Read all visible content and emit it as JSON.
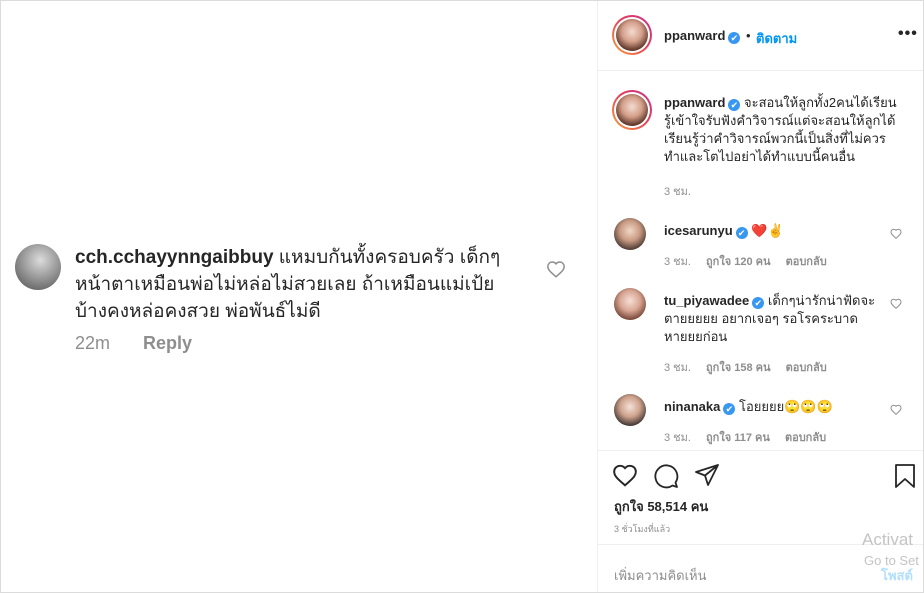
{
  "left_comment": {
    "username": "cch.cchayynngaibbuy",
    "text": " แหมบกันทั้งครอบครัว เด็กๆ หน้าตาเหมือนพ่อไม่หล่อไม่สวยเลย ถ้าเหมือนแม่เป้ย บ้างคงหล่อคงสวย พ่อพันธ์ไม่ดี",
    "time": "22m",
    "reply_label": "Reply"
  },
  "header": {
    "username": "ppanward",
    "verified_mark": "✔",
    "dot": "•",
    "follow_label": "ติดตาม",
    "more_label": "•••"
  },
  "caption": {
    "username": "ppanward",
    "verified_mark": "✔",
    "text": " จะสอนให้ลูกทั้ง2คนได้เรียนรู้เข้าใจรับฟังคำวิจารณ์แต่จะสอนให้ลูกได้เรียนรู้ว่าคำวิจารณ์พวกนี้เป็นสิ่งที่ไม่ควรทำและโตไปอย่าได้ทำแบบนี้คนอื่น",
    "time": "3 ชม."
  },
  "comments": [
    {
      "username": "icesarunyu",
      "verified_mark": "✔",
      "text": "❤️✌️",
      "time": "3 ชม.",
      "likes": "ถูกใจ 120 คน",
      "reply": "ตอบกลับ"
    },
    {
      "username": "tu_piyawadee",
      "verified_mark": "✔",
      "text": "เด็กๆน่ารักน่าฟัดจะตายยยยย อยากเจอๆ รอโรคระบาดหายยยก่อน",
      "time": "3 ชม.",
      "likes": "ถูกใจ 158 คน",
      "reply": "ตอบกลับ"
    },
    {
      "username": "ninanaka",
      "verified_mark": "✔",
      "text": "โอยยยย🙄🙄🙄",
      "time": "3 ชม.",
      "likes": "ถูกใจ 117 คน",
      "reply": "ตอบกลับ"
    }
  ],
  "post_stats": {
    "likes": "ถูกใจ 58,514 คน",
    "time_ago": "3 ชั่วโมงที่แล้ว"
  },
  "add_comment": {
    "placeholder": "เพิ่มความคิดเห็น",
    "post_label": "โพสต์"
  },
  "watermark": {
    "line1": "Activat",
    "line2": "Go to Set"
  },
  "colors": {
    "link_blue": "#0095f6",
    "verified_blue": "#3897f0",
    "muted_text": "#8e8e8e",
    "border": "#efefef"
  }
}
